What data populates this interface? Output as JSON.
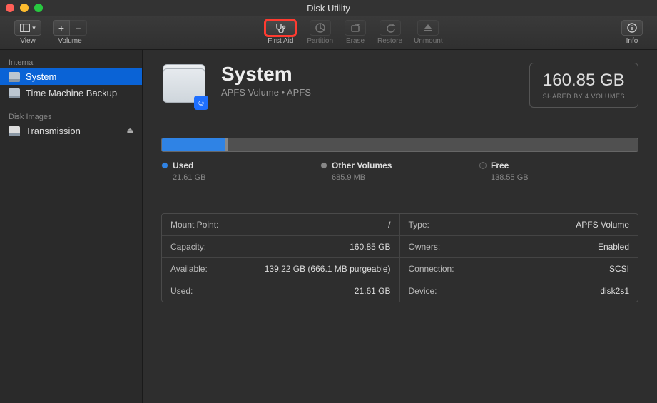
{
  "window": {
    "title": "Disk Utility"
  },
  "toolbar": {
    "view_label": "View",
    "volume_label": "Volume",
    "first_aid_label": "First Aid",
    "partition_label": "Partition",
    "erase_label": "Erase",
    "restore_label": "Restore",
    "unmount_label": "Unmount",
    "info_label": "Info"
  },
  "sidebar": {
    "internal_header": "Internal",
    "disk_images_header": "Disk Images",
    "items": [
      {
        "label": "System",
        "selected": true
      },
      {
        "label": "Time Machine Backup",
        "selected": false
      }
    ],
    "disk_images": [
      {
        "label": "Transmission",
        "eject": "⏏"
      }
    ]
  },
  "volume": {
    "name": "System",
    "subtitle": "APFS Volume • APFS",
    "size": "160.85 GB",
    "shared": "SHARED BY 4 VOLUMES"
  },
  "usage": {
    "used_pct": 13.4,
    "other_pct": 0.5,
    "legend": {
      "used_label": "Used",
      "used_value": "21.61 GB",
      "other_label": "Other Volumes",
      "other_value": "685.9 MB",
      "free_label": "Free",
      "free_value": "138.55 GB"
    }
  },
  "details": {
    "left": [
      {
        "k": "Mount Point:",
        "v": "/"
      },
      {
        "k": "Capacity:",
        "v": "160.85 GB"
      },
      {
        "k": "Available:",
        "v": "139.22 GB (666.1 MB purgeable)"
      },
      {
        "k": "Used:",
        "v": "21.61 GB"
      }
    ],
    "right": [
      {
        "k": "Type:",
        "v": "APFS Volume"
      },
      {
        "k": "Owners:",
        "v": "Enabled"
      },
      {
        "k": "Connection:",
        "v": "SCSI"
      },
      {
        "k": "Device:",
        "v": "disk2s1"
      }
    ]
  }
}
